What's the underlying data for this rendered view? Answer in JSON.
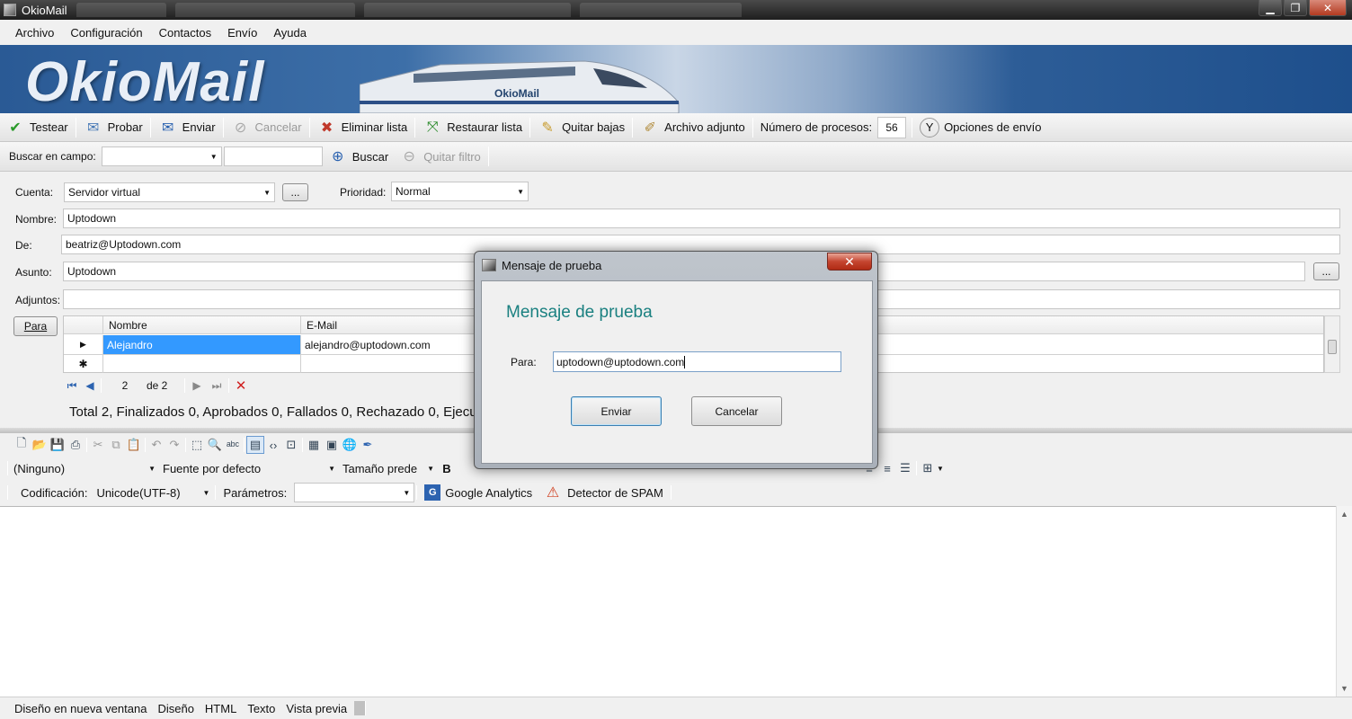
{
  "window": {
    "title": "OkioMail",
    "controls": {
      "minimize": "▁",
      "maximize": "❐",
      "close": "✕"
    }
  },
  "menu": [
    "Archivo",
    "Configuración",
    "Contactos",
    "Envío",
    "Ayuda"
  ],
  "banner": {
    "logo": "OkioMail",
    "train_text": "OkioMail"
  },
  "toolbar": {
    "testear": "Testear",
    "probar": "Probar",
    "enviar": "Enviar",
    "cancelar": "Cancelar",
    "eliminar_lista": "Eliminar lista",
    "restaurar_lista": "Restaurar lista",
    "quitar_bajas": "Quitar bajas",
    "archivo_adjunto": "Archivo adjunto",
    "num_procesos_label": "Número de procesos:",
    "num_procesos_value": "56",
    "opciones_envio": "Opciones de envío"
  },
  "search": {
    "label": "Buscar en campo:",
    "field_value": "",
    "text_value": "",
    "buscar": "Buscar",
    "quitar_filtro": "Quitar filtro"
  },
  "form": {
    "cuenta_label": "Cuenta:",
    "cuenta_value": "Servidor virtual",
    "cuenta_btn": "...",
    "prioridad_label": "Prioridad:",
    "prioridad_value": "Normal",
    "nombre_label": "Nombre:",
    "nombre_value": "Uptodown",
    "de_label": "De:",
    "de_value": "beatriz@Uptodown.com",
    "asunto_label": "Asunto:",
    "asunto_value": "Uptodown",
    "asunto_btn": "...",
    "adjuntos_label": "Adjuntos:",
    "adjuntos_value": "",
    "para_btn": "Para"
  },
  "grid": {
    "columns": [
      "Nombre",
      "E-Mail"
    ],
    "rows": [
      {
        "nombre": "Alejandro",
        "email": "alejandro@uptodown.com"
      }
    ],
    "row_marker": "▶",
    "new_marker": "✱"
  },
  "nav": {
    "page": "2",
    "of": "de 2"
  },
  "totals": "Total 2, Finalizados 0, Aprobados 0, Fallados 0, Rechazado 0, Ejecu",
  "editor_toolbar": {
    "style_value": "(Ninguno)",
    "font_value": "Fuente por defecto",
    "size_value": "Tamaño prede",
    "codificacion_label": "Codificación:",
    "codificacion_value": "Unicode(UTF-8)",
    "parametros_label": "Parámetros:",
    "parametros_value": "",
    "google_analytics": "Google Analytics",
    "detector_spam": "Detector de SPAM"
  },
  "status_tabs": [
    "Diseño en nueva ventana",
    "Diseño",
    "HTML",
    "Texto",
    "Vista previa"
  ],
  "dialog": {
    "title": "Mensaje de prueba",
    "heading": "Mensaje de prueba",
    "para_label": "Para:",
    "para_value": "uptodown@uptodown.com",
    "enviar": "Enviar",
    "cancelar": "Cancelar",
    "close": "✕"
  },
  "colors": {
    "banner_blue": "#2a5a95",
    "dialog_heading": "#1a8080",
    "selected_row": "#3399ff"
  }
}
